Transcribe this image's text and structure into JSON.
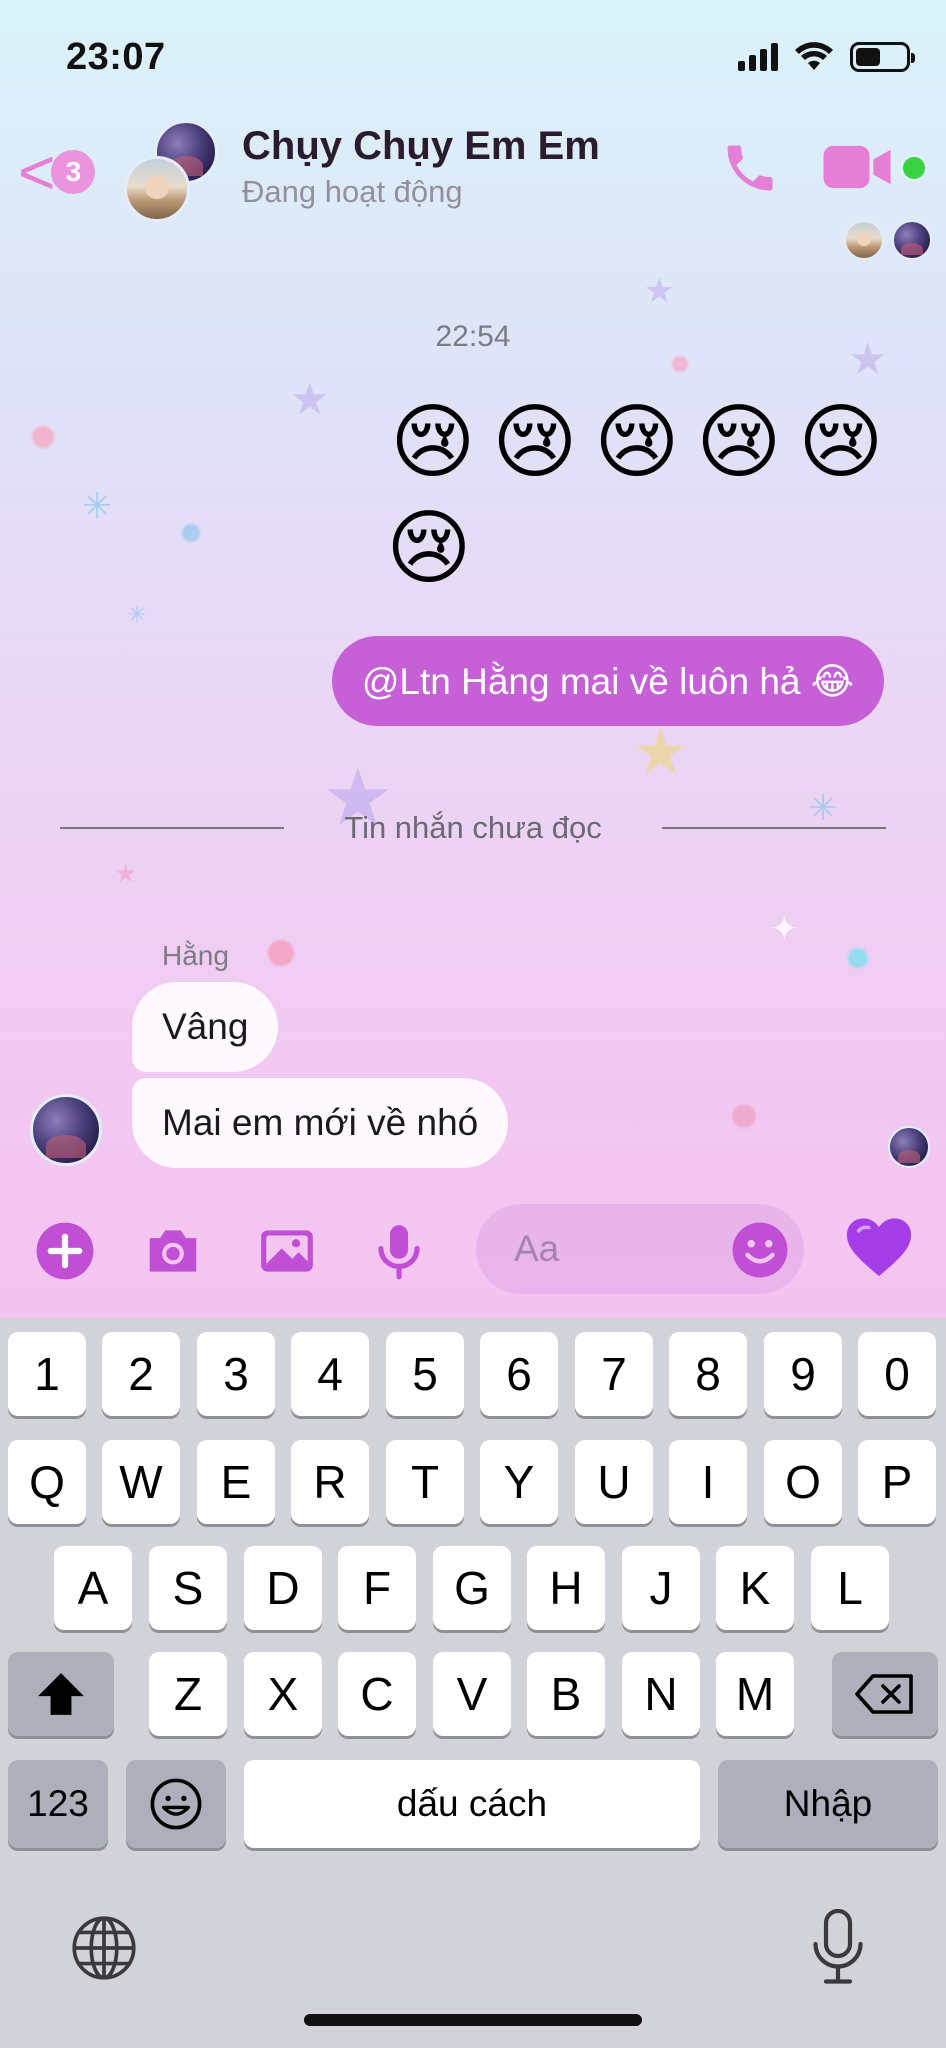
{
  "status_bar": {
    "time": "23:07"
  },
  "header": {
    "back_badge": "3",
    "chat_title": "Chụy Chụy Em Em",
    "chat_status": "Đang hoạt động",
    "icons": [
      "back-chevron-icon",
      "phone-icon",
      "video-camera-icon"
    ]
  },
  "conversation": {
    "timestamp": "22:54",
    "emoji_message": [
      "😢",
      "😢",
      "😢",
      "😢",
      "😢",
      "😢"
    ],
    "outgoing_text": "@Ltn Hằng  mai về luôn hả 😂",
    "unread_divider": "Tin nhắn chưa đọc",
    "incoming_sender": "Hằng",
    "incoming_messages": [
      "Vâng",
      "Mai em mới về nhó"
    ]
  },
  "composer": {
    "placeholder": "Aa",
    "icons": [
      "plus-icon",
      "camera-icon",
      "image-icon",
      "microphone-icon",
      "smile-icon",
      "heart-icon"
    ],
    "heart_color": "#a53ee6",
    "accent_color": "#c04fd6"
  },
  "keyboard": {
    "row_numbers": [
      "1",
      "2",
      "3",
      "4",
      "5",
      "6",
      "7",
      "8",
      "9",
      "0"
    ],
    "row_1": [
      "Q",
      "W",
      "E",
      "R",
      "T",
      "Y",
      "U",
      "I",
      "O",
      "P"
    ],
    "row_2": [
      "A",
      "S",
      "D",
      "F",
      "G",
      "H",
      "J",
      "K",
      "L"
    ],
    "row_3": [
      "Z",
      "X",
      "C",
      "V",
      "B",
      "N",
      "M"
    ],
    "numbers_key": "123",
    "space_key": "dấu cách",
    "return_key": "Nhập"
  }
}
